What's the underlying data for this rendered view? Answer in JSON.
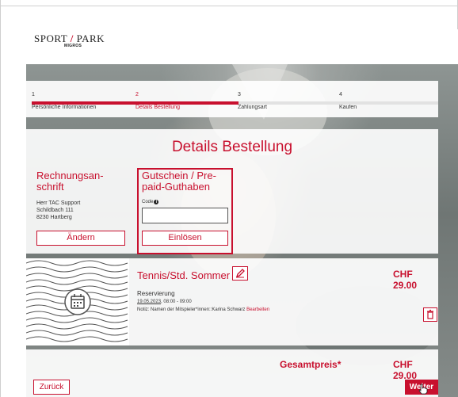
{
  "brand": {
    "name": "SPORT",
    "slash": "/",
    "name2": "PARK",
    "sub": "MIGROS"
  },
  "steps": [
    {
      "num": "1",
      "label": "Persönliche Informationen",
      "state": "done"
    },
    {
      "num": "2",
      "label": "Details Bestellung",
      "state": "active"
    },
    {
      "num": "3",
      "label": "Zahlungsart",
      "state": "pending"
    },
    {
      "num": "4",
      "label": "Kaufen",
      "state": "pending"
    }
  ],
  "details": {
    "title": "Details Bestellung",
    "billing": {
      "heading_line1": "Rechnungsan-",
      "heading_line2": "schrift",
      "address": [
        "Herr TAC Support",
        "Schildbach 111",
        "8230 Hartberg"
      ],
      "change_label": "Ändern"
    },
    "voucher": {
      "heading_line1": "Gutschein / Pre-",
      "heading_line2": "paid-Guthaben",
      "code_label": "Code",
      "code_value": "",
      "redeem_label": "Einlösen"
    }
  },
  "item": {
    "name": "Tennis/Std. Sommer",
    "price": "CHF 29.00",
    "type": "Reservierung",
    "date": "19.05.2023",
    "time": ", 08:00 - 09:00",
    "note": "Notiz: Namen der Mitspieler*innen::Karina Schwarz",
    "edit_label": "Bearbeiten"
  },
  "total": {
    "label": "Gesamtpreis*",
    "price": "CHF 29.00"
  },
  "nav": {
    "back_label": "Zurück",
    "next_label": "Weiter"
  },
  "colors": {
    "accent": "#c8102e",
    "inactive_bar": "#e2e2e2"
  }
}
